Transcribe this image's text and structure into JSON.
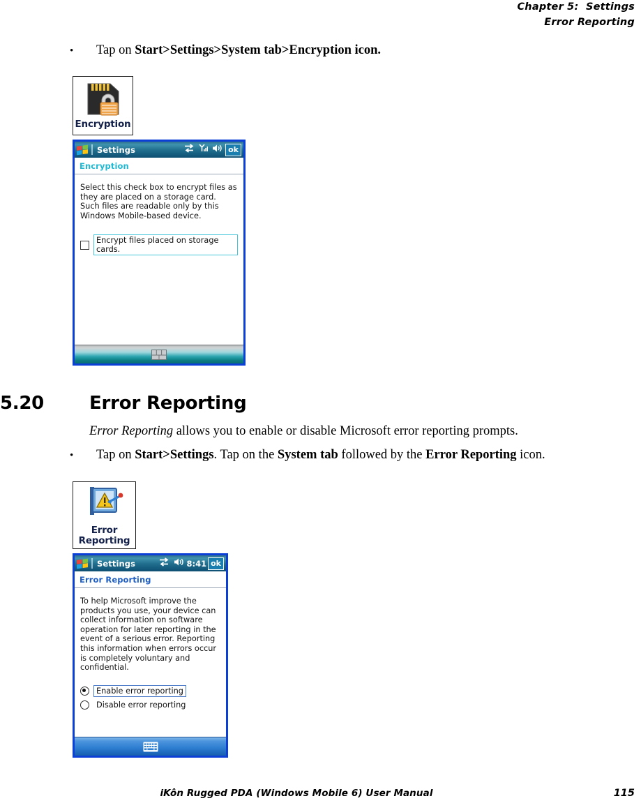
{
  "header": {
    "chapter": "Chapter 5:  Settings",
    "section": "Error Reporting"
  },
  "bullet1": {
    "dot": "•",
    "text_plain_1": "Tap on ",
    "text_bold_1": "Start>Settings>System tab>Encryption icon."
  },
  "encryption_tile": {
    "label": "Encryption",
    "icon": "sd-card-lock-icon"
  },
  "encryption_screen": {
    "titlebar": {
      "flag_icon": "windows-flag-icon",
      "title": "Settings",
      "connectivity_icon": "connectivity-icon",
      "signal_icon": "signal-strength-icon",
      "volume_icon": "volume-icon",
      "ok_label": "ok"
    },
    "subtitle": "Encryption",
    "subtitle_color": "#1fb9d4",
    "body_text": "Select this check box to encrypt files as they are placed on a storage card. Such files are readable only by this Windows Mobile-based device.",
    "checkbox": {
      "label": "Encrypt files placed on storage cards.",
      "checked": false
    },
    "taskbar_icon": "sip-keyboard-icon"
  },
  "section": {
    "number": "5.20",
    "title": "Error Reporting",
    "para_italic": "Error Reporting",
    "para_rest": " allows you to enable or disable Microsoft error reporting prompts."
  },
  "bullet2": {
    "dot": "•",
    "p1": "Tap on ",
    "b1": "Start>Settings",
    "p2": ". Tap on the ",
    "b2": "System tab",
    "p3": " followed by the ",
    "b3": "Error Reporting",
    "p4": " icon."
  },
  "error_tile": {
    "label_line1": "Error",
    "label_line2": "Reporting",
    "icon": "error-reporting-icon"
  },
  "error_screen": {
    "titlebar": {
      "flag_icon": "windows-flag-icon",
      "title": "Settings",
      "connectivity_icon": "connectivity-icon",
      "volume_icon": "volume-icon",
      "time": "8:41",
      "ok_label": "ok"
    },
    "subtitle": "Error Reporting",
    "subtitle_color": "#1f5fc4",
    "body_text": "To help Microsoft improve the products you use, your device can collect information on software operation for later reporting in the event of a serious error. Reporting this information when errors occur is completely voluntary and confidential.",
    "radios": [
      {
        "label": "Enable error reporting",
        "selected": true
      },
      {
        "label": "Disable error reporting",
        "selected": false
      }
    ],
    "taskbar_icon": "sip-keyboard-icon"
  },
  "footer": {
    "title": "iKôn Rugged PDA (Windows Mobile 6) User Manual",
    "page": "115"
  },
  "colors": {
    "device_border": "#0b3fd6",
    "titlebar_teal": "#1f6c8c",
    "subtitle_cyan": "#1fb9d4",
    "subtitle_blue": "#1f5fc4"
  }
}
